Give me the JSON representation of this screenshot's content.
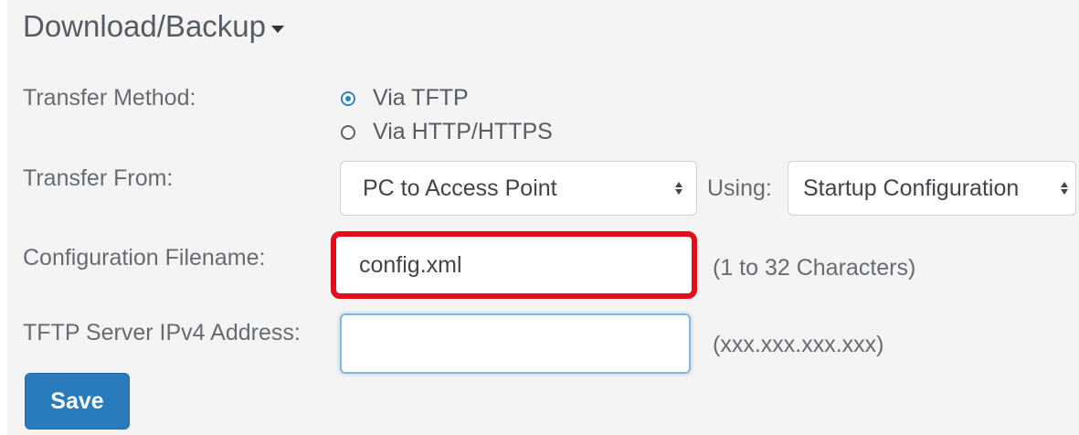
{
  "section": {
    "title": "Download/Backup"
  },
  "transfer_method": {
    "label": "Transfer Method:",
    "options": [
      {
        "label": "Via TFTP",
        "checked": true
      },
      {
        "label": "Via HTTP/HTTPS",
        "checked": false
      }
    ]
  },
  "transfer_from": {
    "label": "Transfer From:",
    "selected": "PC to Access Point",
    "using_label": "Using:",
    "using_selected": "Startup Configuration"
  },
  "config_filename": {
    "label": "Configuration Filename:",
    "value": "config.xml",
    "hint": "(1 to 32 Characters)"
  },
  "tftp_server": {
    "label": "TFTP Server IPv4 Address:",
    "value": "",
    "hint": "(xxx.xxx.xxx.xxx)"
  },
  "actions": {
    "save_label": "Save"
  },
  "colors": {
    "accent": "#2a7bbb",
    "highlight_border": "#e40d1c",
    "panel_bg": "#f4f4f4"
  }
}
